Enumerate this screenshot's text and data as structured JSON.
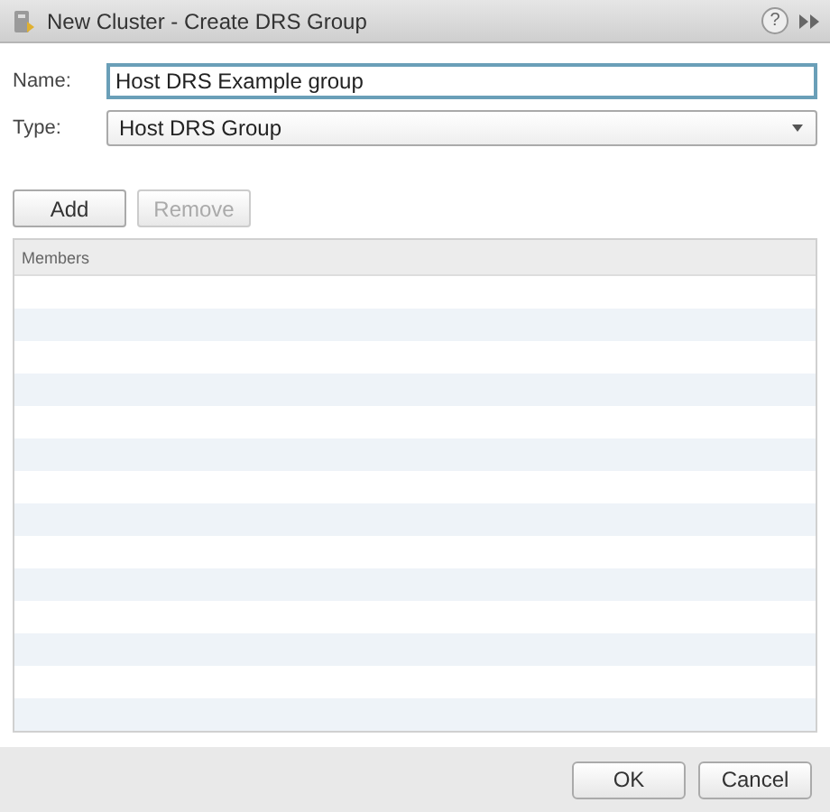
{
  "window": {
    "title": "New Cluster - Create DRS Group",
    "help_icon": "?"
  },
  "fields": [
    {
      "label": "Name:",
      "kind": "text",
      "value": "Host DRS Example group",
      "focused": true
    },
    {
      "label": "Type:",
      "kind": "select",
      "value": "Host DRS Group",
      "focused": false
    }
  ],
  "toolbar": [
    {
      "label": "Add",
      "disabled": false
    },
    {
      "label": "Remove",
      "disabled": true
    }
  ],
  "table": {
    "columns": [
      "Members"
    ]
  },
  "buttons": [
    "OK",
    "Cancel"
  ]
}
